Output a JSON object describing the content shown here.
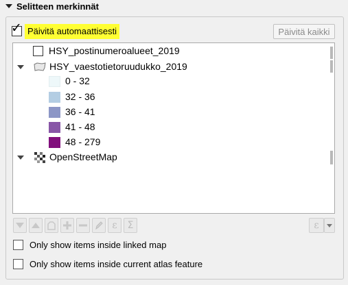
{
  "panel": {
    "title": "Selitteen merkinnät"
  },
  "auto_update": {
    "label": "Päivitä automaattisesti",
    "checked": true,
    "highlight_color": "#ffff33"
  },
  "update_all_button": {
    "label": "Päivitä kaikki",
    "enabled": false
  },
  "tree": {
    "layer1": {
      "label": "HSY_postinumeroalueet_2019",
      "checked": false
    },
    "layer2": {
      "label": "HSY_vaestotietoruudukko_2019",
      "expanded": true,
      "classes": [
        {
          "label": "0 - 32",
          "color": "#eef8fa"
        },
        {
          "label": "32 - 36",
          "color": "#b3cde3"
        },
        {
          "label": "36 - 41",
          "color": "#8c96c6"
        },
        {
          "label": "41 - 48",
          "color": "#8856a7"
        },
        {
          "label": "48 - 279",
          "color": "#810f7c"
        }
      ]
    },
    "layer3": {
      "label": "OpenStreetMap",
      "expanded": true
    }
  },
  "toolbar": {
    "icons": [
      "move-down-icon",
      "move-up-icon",
      "add-group-icon",
      "add-item-icon",
      "remove-item-icon",
      "edit-icon",
      "expression-icon",
      "sum-icon",
      "filter-expression-icon"
    ]
  },
  "options": {
    "linked_map_label": "Only show items inside linked map",
    "atlas_label": "Only show items inside current atlas feature"
  }
}
